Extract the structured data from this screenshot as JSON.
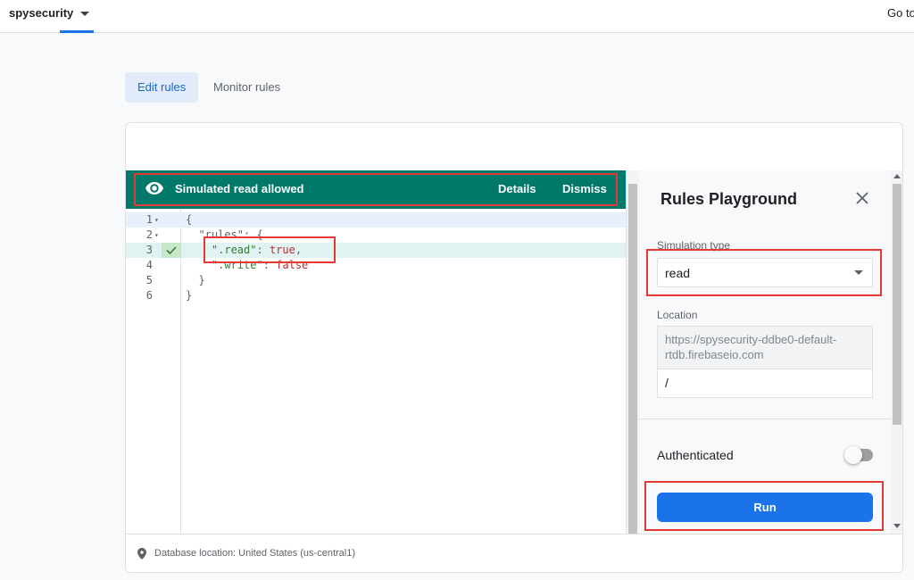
{
  "header": {
    "project_name": "spysecurity",
    "goto_label": "Go to"
  },
  "tabs": [
    {
      "label": "Edit rules",
      "active": true
    },
    {
      "label": "Monitor rules",
      "active": false
    }
  ],
  "banner": {
    "message": "Simulated read allowed",
    "details_label": "Details",
    "dismiss_label": "Dismiss",
    "color": "#00796b"
  },
  "editor": {
    "lines": [
      {
        "num": "1",
        "fold": "▾",
        "text": "{"
      },
      {
        "num": "2",
        "fold": "▾",
        "text": "  \"rules\": {"
      },
      {
        "num": "3",
        "fold": "",
        "text": "    \".read\": true,"
      },
      {
        "num": "4",
        "fold": "",
        "text": "    \".write\": false"
      },
      {
        "num": "5",
        "fold": "",
        "text": "  }"
      },
      {
        "num": "6",
        "fold": "",
        "text": "}"
      }
    ],
    "tokens": {
      "rules_key": "\"rules\"",
      "read_key": "\".read\"",
      "read_val": "true",
      "write_key": "\".write\"",
      "write_val": "false"
    }
  },
  "playground": {
    "title": "Rules Playground",
    "simulation_type_label": "Simulation type",
    "simulation_type_value": "read",
    "location_label": "Location",
    "location_prefix": "https://spysecurity-ddbe0-default-rtdb.firebaseio.com",
    "location_path": "/",
    "authenticated_label": "Authenticated",
    "authenticated": false,
    "run_label": "Run",
    "run_color": "#1a73e8"
  },
  "footer": {
    "database_location": "Database location: United States (us-central1)"
  }
}
